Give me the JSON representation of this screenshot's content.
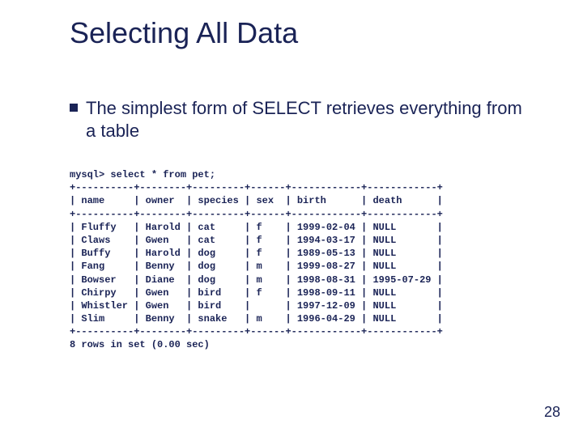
{
  "title": "Selecting All Data",
  "bullet": "The simplest form of SELECT retrieves everything from a table",
  "page_number": "28",
  "sql": {
    "prompt": "mysql> select * from pet;",
    "columns": [
      "name",
      "owner",
      "species",
      "sex",
      "birth",
      "death"
    ],
    "rows": [
      {
        "name": "Fluffy",
        "owner": "Harold",
        "species": "cat",
        "sex": "f",
        "birth": "1999-02-04",
        "death": "NULL"
      },
      {
        "name": "Claws",
        "owner": "Gwen",
        "species": "cat",
        "sex": "f",
        "birth": "1994-03-17",
        "death": "NULL"
      },
      {
        "name": "Buffy",
        "owner": "Harold",
        "species": "dog",
        "sex": "f",
        "birth": "1989-05-13",
        "death": "NULL"
      },
      {
        "name": "Fang",
        "owner": "Benny",
        "species": "dog",
        "sex": "m",
        "birth": "1999-08-27",
        "death": "NULL"
      },
      {
        "name": "Bowser",
        "owner": "Diane",
        "species": "dog",
        "sex": "m",
        "birth": "1998-08-31",
        "death": "1995-07-29"
      },
      {
        "name": "Chirpy",
        "owner": "Gwen",
        "species": "bird",
        "sex": "f",
        "birth": "1998-09-11",
        "death": "NULL"
      },
      {
        "name": "Whistler",
        "owner": "Gwen",
        "species": "bird",
        "sex": "",
        "birth": "1997-12-09",
        "death": "NULL"
      },
      {
        "name": "Slim",
        "owner": "Benny",
        "species": "snake",
        "sex": "m",
        "birth": "1996-04-29",
        "death": "NULL"
      }
    ],
    "footer": "8 rows in set (0.00 sec)"
  }
}
